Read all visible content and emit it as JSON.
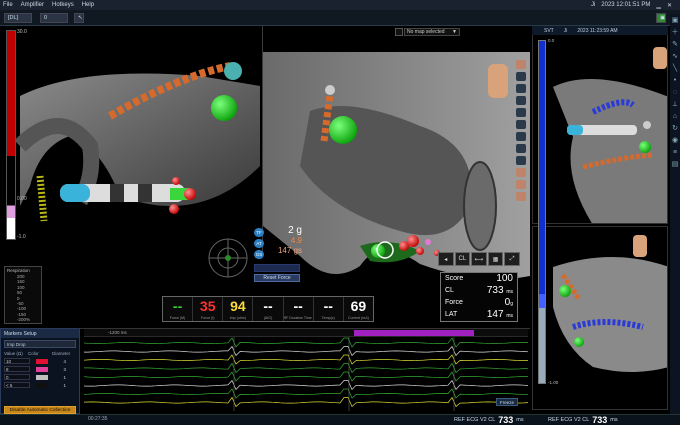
{
  "menu": {
    "items": [
      "File",
      "Amplifier",
      "Hotkeys",
      "Help"
    ],
    "user": "Ji",
    "clock": "2023 12:01:51 PM"
  },
  "toolbar": {
    "labels": [
      "[DL]",
      "0"
    ]
  },
  "left_scale": {
    "top": "30.0",
    "mid": "0.00",
    "bottom": "-1.0"
  },
  "map_select": {
    "placeholder": "No map selected"
  },
  "respiration": {
    "title": "Respiration",
    "values": [
      "200",
      "150",
      "100",
      "50",
      "0",
      "-50",
      "-100",
      "-150",
      "-200%"
    ]
  },
  "force": {
    "badge1": "TF",
    "badge2": "AT",
    "badge3": "GS",
    "total": "2 g",
    "axial": "4.9",
    "lateral": "147 gs",
    "reset_label": "Reset Force"
  },
  "metrics": [
    {
      "value": "--",
      "label": "Force (M)",
      "color": "#35d035"
    },
    {
      "value": "35",
      "label": "Force (t)",
      "color": "#ff3030"
    },
    {
      "value": "94",
      "label": "Imp (ohm)",
      "color": "#ffd93a"
    },
    {
      "value": "--",
      "label": "(AIG)",
      "color": "#ffffff"
    },
    {
      "value": "--",
      "label": "RF Duration Time (s)",
      "color": "#ffffff"
    },
    {
      "value": "--",
      "label": "Temp(c)",
      "color": "#ffffff"
    },
    {
      "value": "69",
      "label": "Current (mA)",
      "color": "#ffffff"
    }
  ],
  "score_toolbar": [
    "CL"
  ],
  "score": {
    "score_label": "Score",
    "score_val": "100",
    "cl_label": "CL",
    "cl_val": "733",
    "cl_unit": "ms",
    "force_label": "Force",
    "force_val": "0",
    "force_unit": "g",
    "lat_label": "LAT",
    "lat_val": "147",
    "lat_unit": "ms"
  },
  "right_view": {
    "mode": "SVT",
    "user": "Ji",
    "time": "2023 11:23:59 AM"
  },
  "right_scale": {
    "top": "0.0",
    "bottom": "-1.00"
  },
  "legend": {
    "title": "Markers Setup",
    "dropdown": "Imp Drop",
    "headers": [
      "Value (Ω)",
      "Color",
      "Diameter"
    ],
    "rows": [
      {
        "value": "10",
        "color": "#e01030",
        "diameter": "4"
      },
      {
        "value": "8",
        "color": "#e0409a",
        "diameter": "3"
      },
      {
        "value": "0",
        "color": "#c0c0c0",
        "diameter": "1"
      },
      {
        "value": "< 5",
        "color": "#101010",
        "diameter": "1"
      }
    ],
    "button": "Disable Automatic Collection"
  },
  "egm": {
    "header_time": "-1200 ms",
    "freeze_label": "Freeze"
  },
  "status": {
    "time": "00:27:35",
    "ref1_prefix": "REF ECG V2 CL",
    "ref1_value": "733",
    "ref1_unit": "ms",
    "ref2_prefix": "REF ECG V2 CL",
    "ref2_value": "733",
    "ref2_unit": "ms"
  }
}
